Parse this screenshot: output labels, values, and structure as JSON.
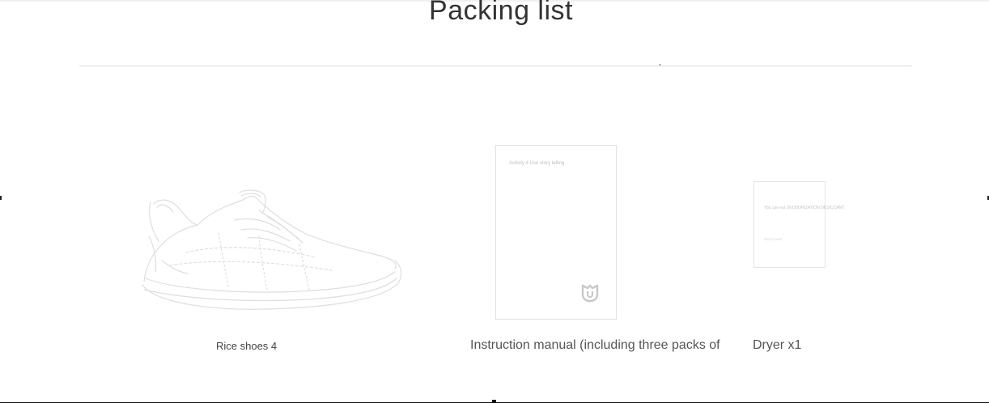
{
  "page": {
    "title": "Packing list"
  },
  "items": [
    {
      "caption": "Rice shoes 4",
      "icon": "sneaker-outline-icon"
    },
    {
      "caption": "Instruction manual (including three packs of",
      "icon": "manual-booklet-icon",
      "booklet_text": "Activity 4 Use story telling"
    },
    {
      "caption": "Dryer x1",
      "icon": "dryer-card-icon",
      "card_text": "You can eat DEODORIZATION DESICCANT",
      "card_subtext": "DESICCANT"
    }
  ],
  "colors": {
    "line_art": "#dedede",
    "divider": "#dcdcdc",
    "title": "#333333",
    "caption": "#555555"
  }
}
